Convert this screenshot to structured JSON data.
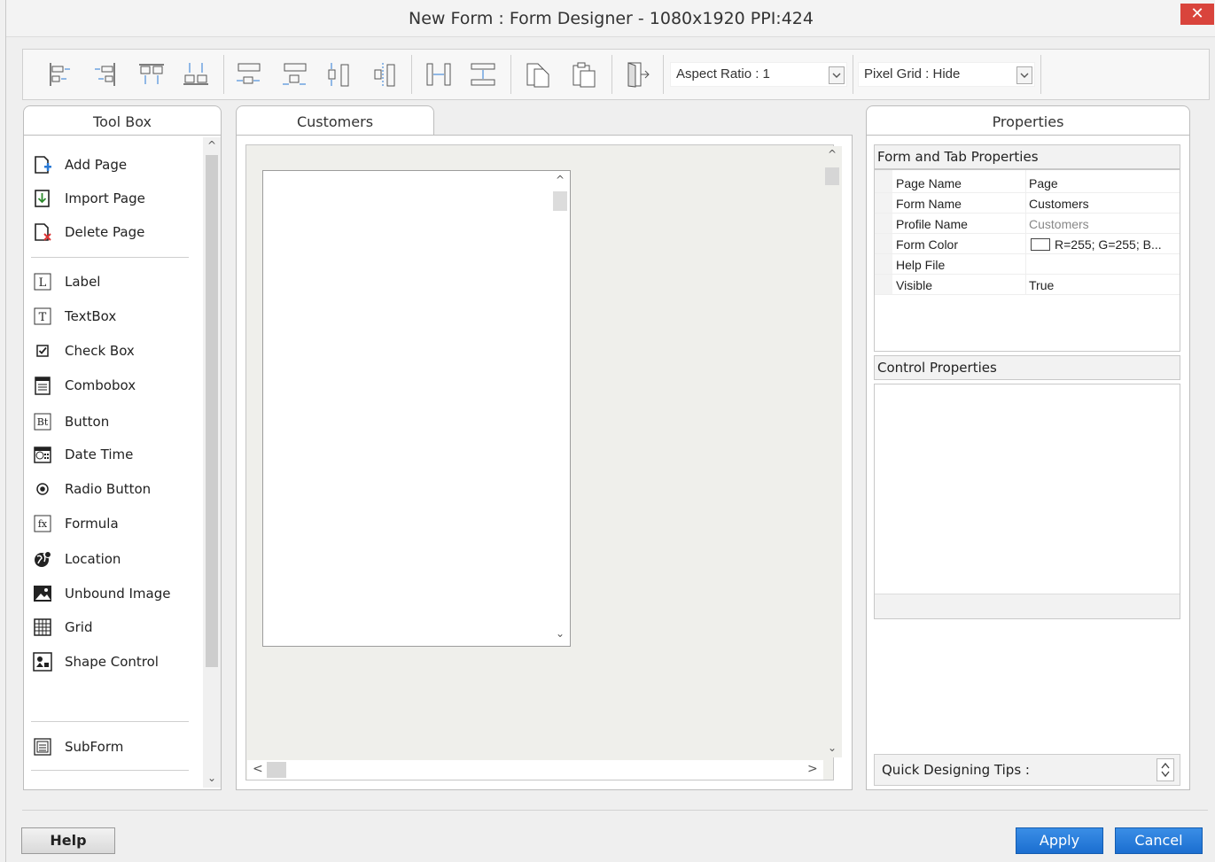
{
  "window": {
    "title": "New Form : Form Designer - 1080x1920 PPI:424",
    "close_glyph": "✕"
  },
  "toolbar": {
    "buttons": [
      {
        "name": "align-left-icon"
      },
      {
        "name": "align-right-icon"
      },
      {
        "name": "align-top-icon"
      },
      {
        "name": "align-bottom-icon"
      },
      {
        "name": "center-horizontal-icon"
      },
      {
        "name": "center-horizontal-alt-icon"
      },
      {
        "name": "center-vertical-icon"
      },
      {
        "name": "center-vertical-alt-icon"
      },
      {
        "name": "space-horizontal-icon"
      },
      {
        "name": "space-vertical-icon"
      },
      {
        "name": "copy-icon"
      },
      {
        "name": "paste-icon"
      },
      {
        "name": "exit-icon"
      }
    ],
    "aspect_ratio": "Aspect Ratio : 1",
    "pixel_grid": "Pixel Grid : Hide"
  },
  "toolbox": {
    "title": "Tool Box",
    "pages": [
      {
        "label": "Add Page",
        "icon": "add-page-icon"
      },
      {
        "label": "Import Page",
        "icon": "import-page-icon"
      },
      {
        "label": "Delete Page",
        "icon": "delete-page-icon"
      }
    ],
    "controls": [
      {
        "label": "Label",
        "icon": "label-icon",
        "glyph": "L"
      },
      {
        "label": "TextBox",
        "icon": "textbox-icon",
        "glyph": "T"
      },
      {
        "label": "Check Box",
        "icon": "checkbox-icon",
        "glyph": "☑"
      },
      {
        "label": "Combobox",
        "icon": "combobox-icon",
        "glyph": "≣"
      },
      {
        "label": "Button",
        "icon": "button-icon",
        "glyph": "Bt"
      },
      {
        "label": "Date Time",
        "icon": "date-time-icon",
        "glyph": "▦"
      },
      {
        "label": "Radio Button",
        "icon": "radio-button-icon",
        "glyph": "⦿"
      },
      {
        "label": "Formula",
        "icon": "formula-icon",
        "glyph": "fx"
      },
      {
        "label": "Location",
        "icon": "location-icon",
        "glyph": "⊕"
      },
      {
        "label": "Unbound Image",
        "icon": "image-icon",
        "glyph": "▣"
      },
      {
        "label": "Grid",
        "icon": "grid-icon",
        "glyph": "▦"
      },
      {
        "label": "Shape Control",
        "icon": "shape-icon",
        "glyph": "■"
      }
    ],
    "subform": {
      "label": "SubForm",
      "icon": "subform-icon"
    }
  },
  "designer": {
    "tab": "Customers"
  },
  "properties": {
    "title": "Properties",
    "form_tab_header": "Form and Tab Properties",
    "rows": [
      {
        "key": "Page Name",
        "value": "Page"
      },
      {
        "key": "Form Name",
        "value": "Customers"
      },
      {
        "key": "Profile Name",
        "value": "Customers"
      },
      {
        "key": "Form Color",
        "value": "R=255; G=255; B..."
      },
      {
        "key": "Help File",
        "value": ""
      },
      {
        "key": "Visible",
        "value": "True"
      }
    ],
    "control_header": "Control Properties",
    "tips_label": "Quick Designing Tips :"
  },
  "footer": {
    "help": "Help",
    "apply": "Apply",
    "cancel": "Cancel"
  },
  "colors": {
    "accent": "#1b6ed0",
    "close": "#d9443c"
  }
}
